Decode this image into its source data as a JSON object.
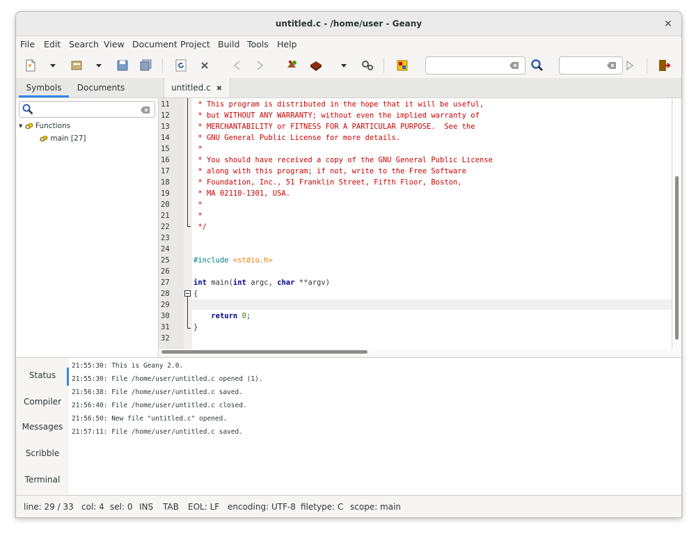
{
  "window": {
    "title": "untitled.c - /home/user - Geany",
    "close_glyph": "×"
  },
  "menu": [
    "File",
    "Edit",
    "Search",
    "View",
    "Document",
    "Project",
    "Build",
    "Tools",
    "Help"
  ],
  "toolbar": {
    "icons": [
      "new-file-icon",
      "dropdown-icon",
      "open-file-icon",
      "dropdown-icon",
      "save-icon",
      "save-all-icon",
      "reload-icon",
      "close-icon",
      "back-icon",
      "forward-icon",
      "compile-icon",
      "build-icon",
      "dropdown-icon",
      "execute-icon",
      "color-chooser-icon",
      "search-icon",
      "jump-to-line-icon",
      "quit-icon"
    ],
    "search_value": "",
    "goto_value": ""
  },
  "sidebar": {
    "tabs": [
      "Symbols",
      "Documents"
    ],
    "active_tab": "Symbols",
    "search_value": "",
    "tree": {
      "group": "Functions",
      "items": [
        "main [27]"
      ]
    }
  },
  "editor": {
    "tab_label": "untitled.c",
    "tab_close": "✖",
    "line_numbers": [
      "11",
      "12",
      "13",
      "14",
      "15",
      "16",
      "17",
      "18",
      "19",
      "20",
      "21",
      "22",
      "23",
      "24",
      "25",
      "26",
      "27",
      "28",
      "29",
      "30",
      "31",
      "32"
    ],
    "comment_lines": [
      " * This program is distributed in the hope that it will be useful,",
      " * but WITHOUT ANY WARRANTY; without even the implied warranty of",
      " * MERCHANTABILITY or FITNESS FOR A PARTICULAR PURPOSE.  See the",
      " * GNU General Public License for more details.",
      " *",
      " * You should have received a copy of the GNU General Public License",
      " * along with this program; if not, write to the Free Software",
      " * Foundation, Inc., 51 Franklin Street, Fifth Floor, Boston,",
      " * MA 02110-1301, USA.",
      " *",
      " *",
      " */"
    ],
    "include_directive": "#include",
    "include_file": " <stdio.h>",
    "main_sig": {
      "kw1": "int",
      "t1": " main(",
      "kw2": "int",
      "t2": " argc, ",
      "kw3": "char",
      "t3": " **argv)"
    },
    "open_brace": "{",
    "return_kw": "return",
    "return_val": "0",
    "return_end": ";",
    "close_brace": "}"
  },
  "messages": {
    "tabs": [
      "Status",
      "Compiler",
      "Messages",
      "Scribble",
      "Terminal"
    ],
    "active_tab": "Status",
    "lines": [
      "21:55:30: This is Geany 2.0.",
      "21:55:30: File /home/user/untitled.c opened (1).",
      "21:56:38: File /home/user/untitled.c saved.",
      "21:56:40: File /home/user/untitled.c closed.",
      "21:56:50: New file \"untitled.c\" opened.",
      "21:57:11: File /home/user/untitled.c saved."
    ]
  },
  "status": {
    "line": "line: 29 / 33",
    "col": "col: 4",
    "sel": "sel: 0",
    "mode": "INS",
    "indent": "TAB",
    "eol": "EOL: LF",
    "encoding": "encoding: UTF-8",
    "filetype": "filetype: C",
    "scope": "scope: main"
  },
  "colors": {
    "accent": "#3584e4",
    "comment": "#cc0000",
    "keyword": "#00008b",
    "preprocessor": "#008080",
    "string": "#f57900"
  }
}
